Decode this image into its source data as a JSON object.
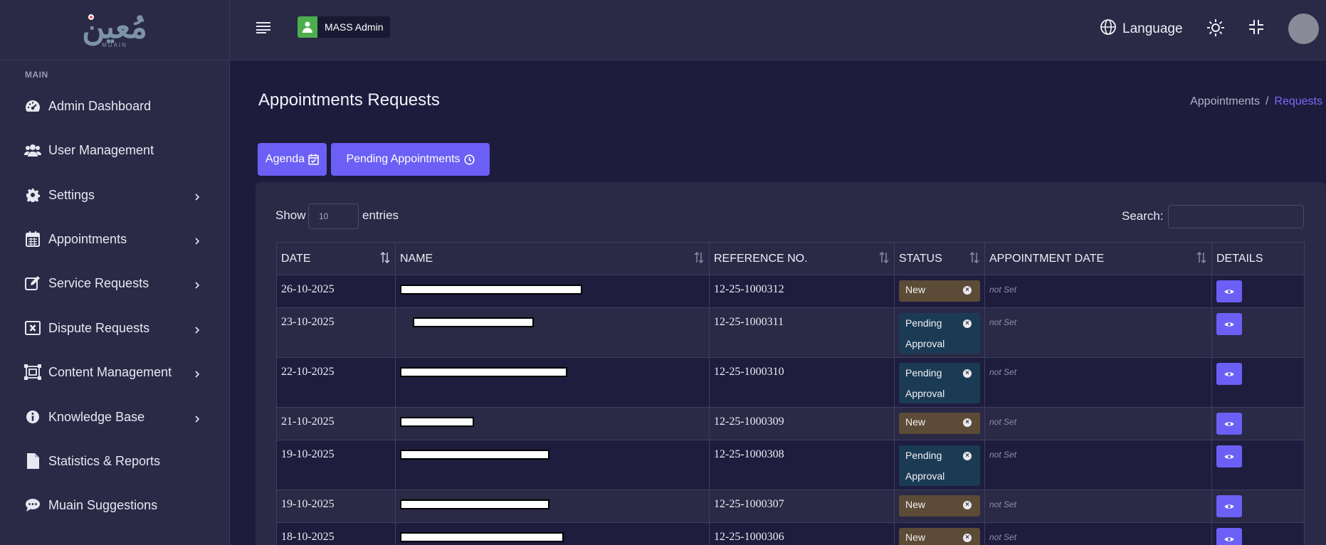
{
  "brand": {
    "logo_text": "مُعين",
    "logo_sub": "MUAIN"
  },
  "sidebar": {
    "section_label": "MAIN",
    "items": [
      {
        "label": "Admin Dashboard",
        "icon": "dashboard-icon",
        "has_children": false
      },
      {
        "label": "User Management",
        "icon": "users-icon",
        "has_children": false
      },
      {
        "label": "Settings",
        "icon": "gear-icon",
        "has_children": true
      },
      {
        "label": "Appointments",
        "icon": "calendar-icon",
        "has_children": true
      },
      {
        "label": "Service Requests",
        "icon": "edit-icon",
        "has_children": true
      },
      {
        "label": "Dispute Requests",
        "icon": "x-square-icon",
        "has_children": true
      },
      {
        "label": "Content Management",
        "icon": "frame-icon",
        "has_children": true
      },
      {
        "label": "Knowledge Base",
        "icon": "info-icon",
        "has_children": true
      },
      {
        "label": "Statistics & Reports",
        "icon": "file-icon",
        "has_children": false
      },
      {
        "label": "Muain Suggestions",
        "icon": "comment-icon",
        "has_children": false
      }
    ]
  },
  "header": {
    "admin_label": "MASS Admin",
    "language_label": "Language"
  },
  "page": {
    "title": "Appointments Requests",
    "breadcrumb": {
      "parent": "Appointments",
      "separator": "/",
      "current": "Requests"
    },
    "buttons": {
      "agenda": "Agenda",
      "pending": "Pending Appointments"
    }
  },
  "table_controls": {
    "show_label": "Show",
    "entries_value": "10",
    "entries_label": "entries",
    "search_label": "Search:"
  },
  "table": {
    "headers": [
      "DATE",
      "NAME",
      "REFERENCE NO.",
      "STATUS",
      "APPOINTMENT DATE",
      "DETAILS"
    ],
    "rows": [
      {
        "date": "26-10-2025",
        "reference": "12-25-1000312",
        "status": "New",
        "appointment_date": "not Set"
      },
      {
        "date": "23-10-2025",
        "reference": "12-25-1000311",
        "status_line1": "Pending",
        "status_line2": "Approval",
        "appointment_date": "not Set"
      },
      {
        "date": "22-10-2025",
        "reference": "12-25-1000310",
        "status_line1": "Pending",
        "status_line2": "Approval",
        "appointment_date": "not Set"
      },
      {
        "date": "21-10-2025",
        "reference": "12-25-1000309",
        "status": "New",
        "appointment_date": "not Set"
      },
      {
        "date": "19-10-2025",
        "reference": "12-25-1000308",
        "status_line1": "Pending",
        "status_line2": "Approval",
        "appointment_date": "not Set"
      },
      {
        "date": "19-10-2025",
        "reference": "12-25-1000307",
        "status": "New",
        "appointment_date": "not Set"
      },
      {
        "date": "18-10-2025",
        "reference": "12-25-1000306",
        "status": "New",
        "appointment_date": "not Set"
      }
    ]
  },
  "colors": {
    "accent": "#6c5ff5",
    "sidebar_bg": "#2a2946",
    "page_bg": "#1d1c3d",
    "status_new": "#5b4b37",
    "status_pending": "#1b3b55"
  }
}
